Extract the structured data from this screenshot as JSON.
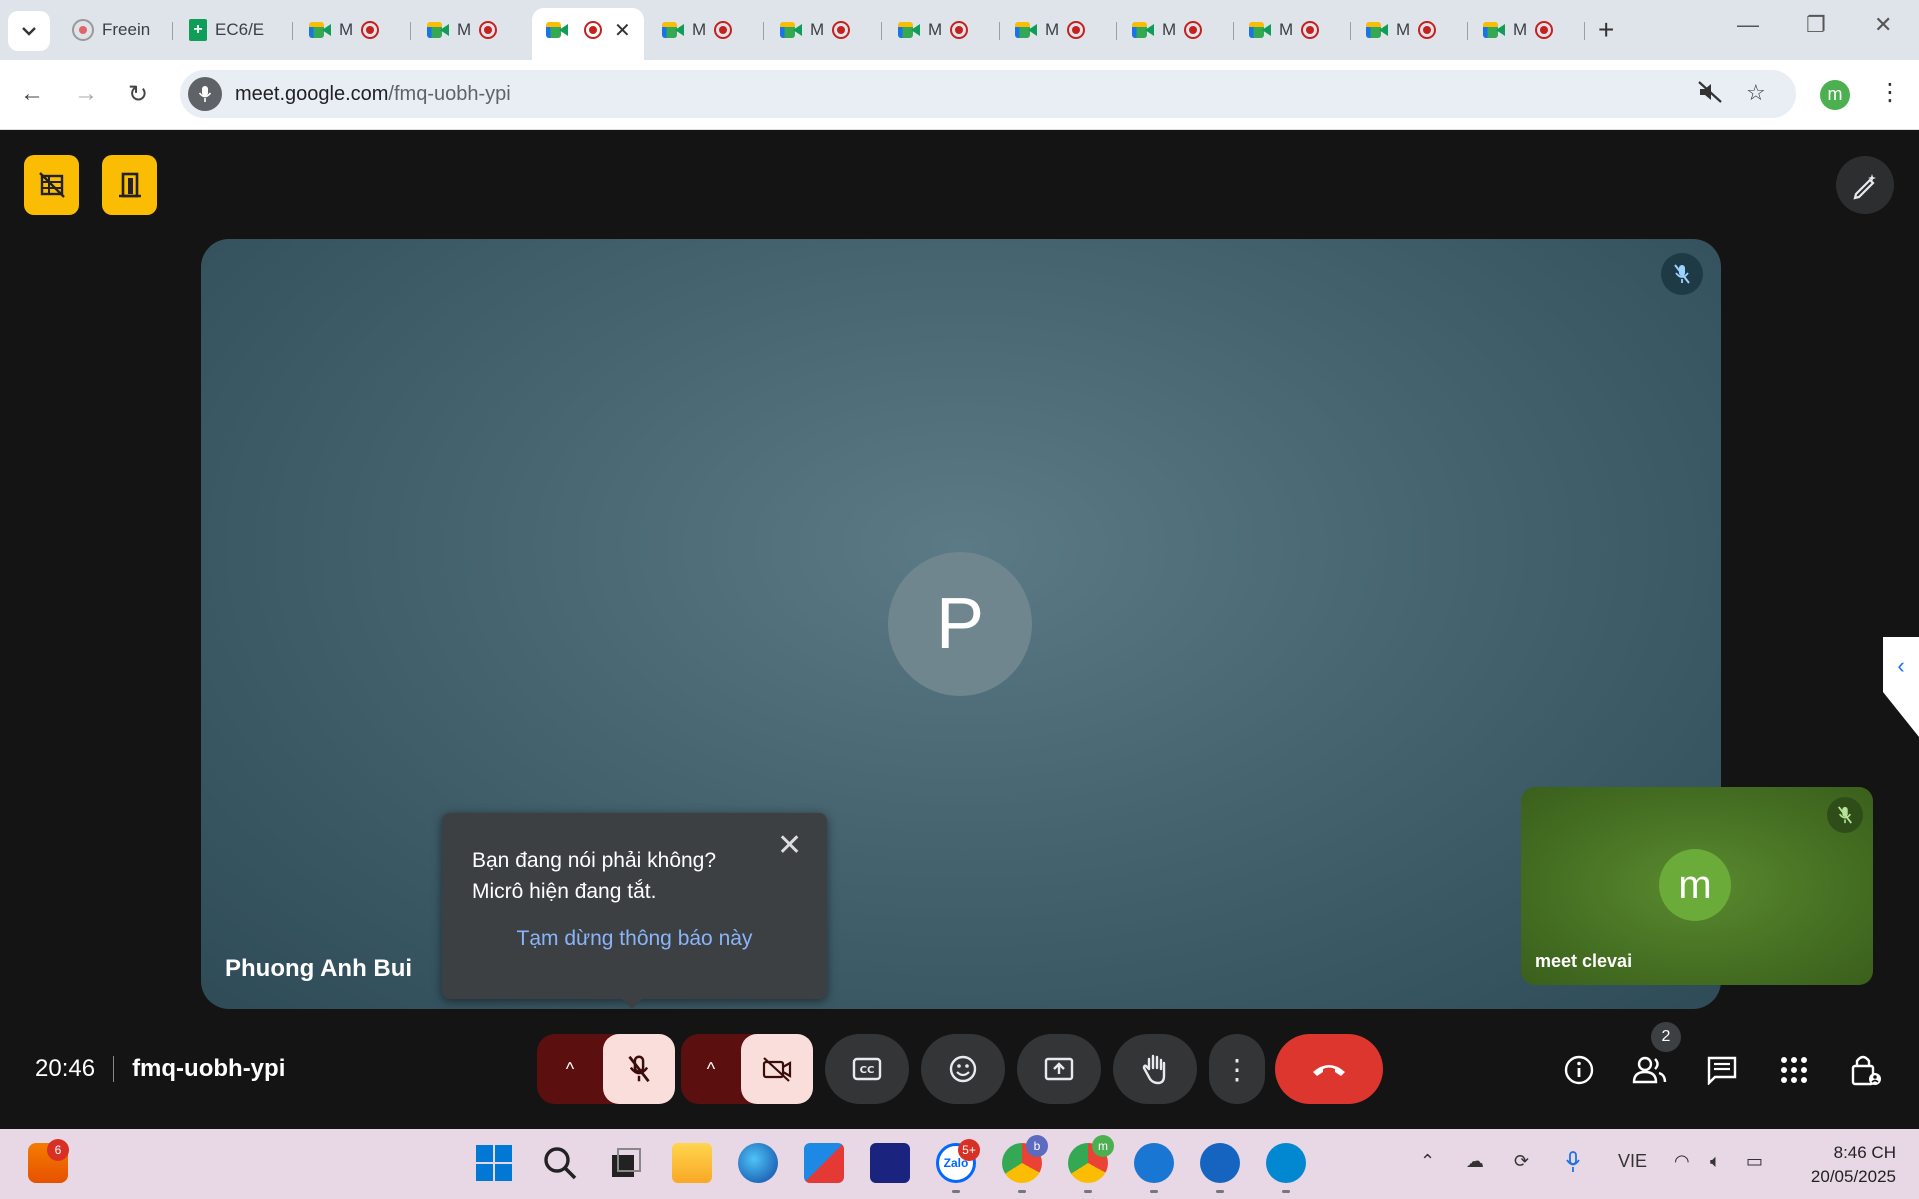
{
  "browser": {
    "tabs": [
      {
        "label": "Freein",
        "favicon": "freein-icon"
      },
      {
        "label": "EC6/E",
        "favicon": "sheets-icon"
      },
      {
        "label": "M",
        "favicon": "meet-icon"
      },
      {
        "label": "M",
        "favicon": "meet-icon"
      },
      {
        "label": "",
        "favicon": "meet-icon"
      },
      {
        "label": "M",
        "favicon": "meet-icon"
      },
      {
        "label": "M",
        "favicon": "meet-icon"
      },
      {
        "label": "M",
        "favicon": "meet-icon"
      },
      {
        "label": "M",
        "favicon": "meet-icon"
      },
      {
        "label": "M",
        "favicon": "meet-icon"
      },
      {
        "label": "M",
        "favicon": "meet-icon"
      },
      {
        "label": "M",
        "favicon": "meet-icon"
      },
      {
        "label": "M",
        "favicon": "meet-icon"
      }
    ],
    "active_tab_index": 4,
    "url_host": "meet.google.com",
    "url_path": "/fmq-uobh-ypi",
    "profile_initial": "m"
  },
  "meeting": {
    "main_participant": {
      "name": "Phuong Anh Bui",
      "initial": "P",
      "muted": true
    },
    "self_participant": {
      "name": "meet clevai",
      "initial": "m",
      "muted": true
    },
    "time": "20:46",
    "code": "fmq-uobh-ypi",
    "participant_count": "2",
    "tooltip": {
      "line1": "Bạn đang nói phải không?",
      "line2": "Micrô hiện đang tắt.",
      "link": "Tạm dừng thông báo này"
    }
  },
  "taskbar": {
    "widget_badge": "6",
    "zalo_badge": "5+",
    "zalo_label": "Zalo",
    "chrome_b_badge": "b",
    "chrome_m_badge": "m",
    "language": "VIE",
    "clock_time": "8:46 CH",
    "clock_date": "20/05/2025"
  },
  "colors": {
    "accent_yellow": "#fbbc04",
    "hangup_red": "#dc362e",
    "muted_btn_bg": "#f9dedc",
    "link_blue": "#8ab4f8"
  }
}
